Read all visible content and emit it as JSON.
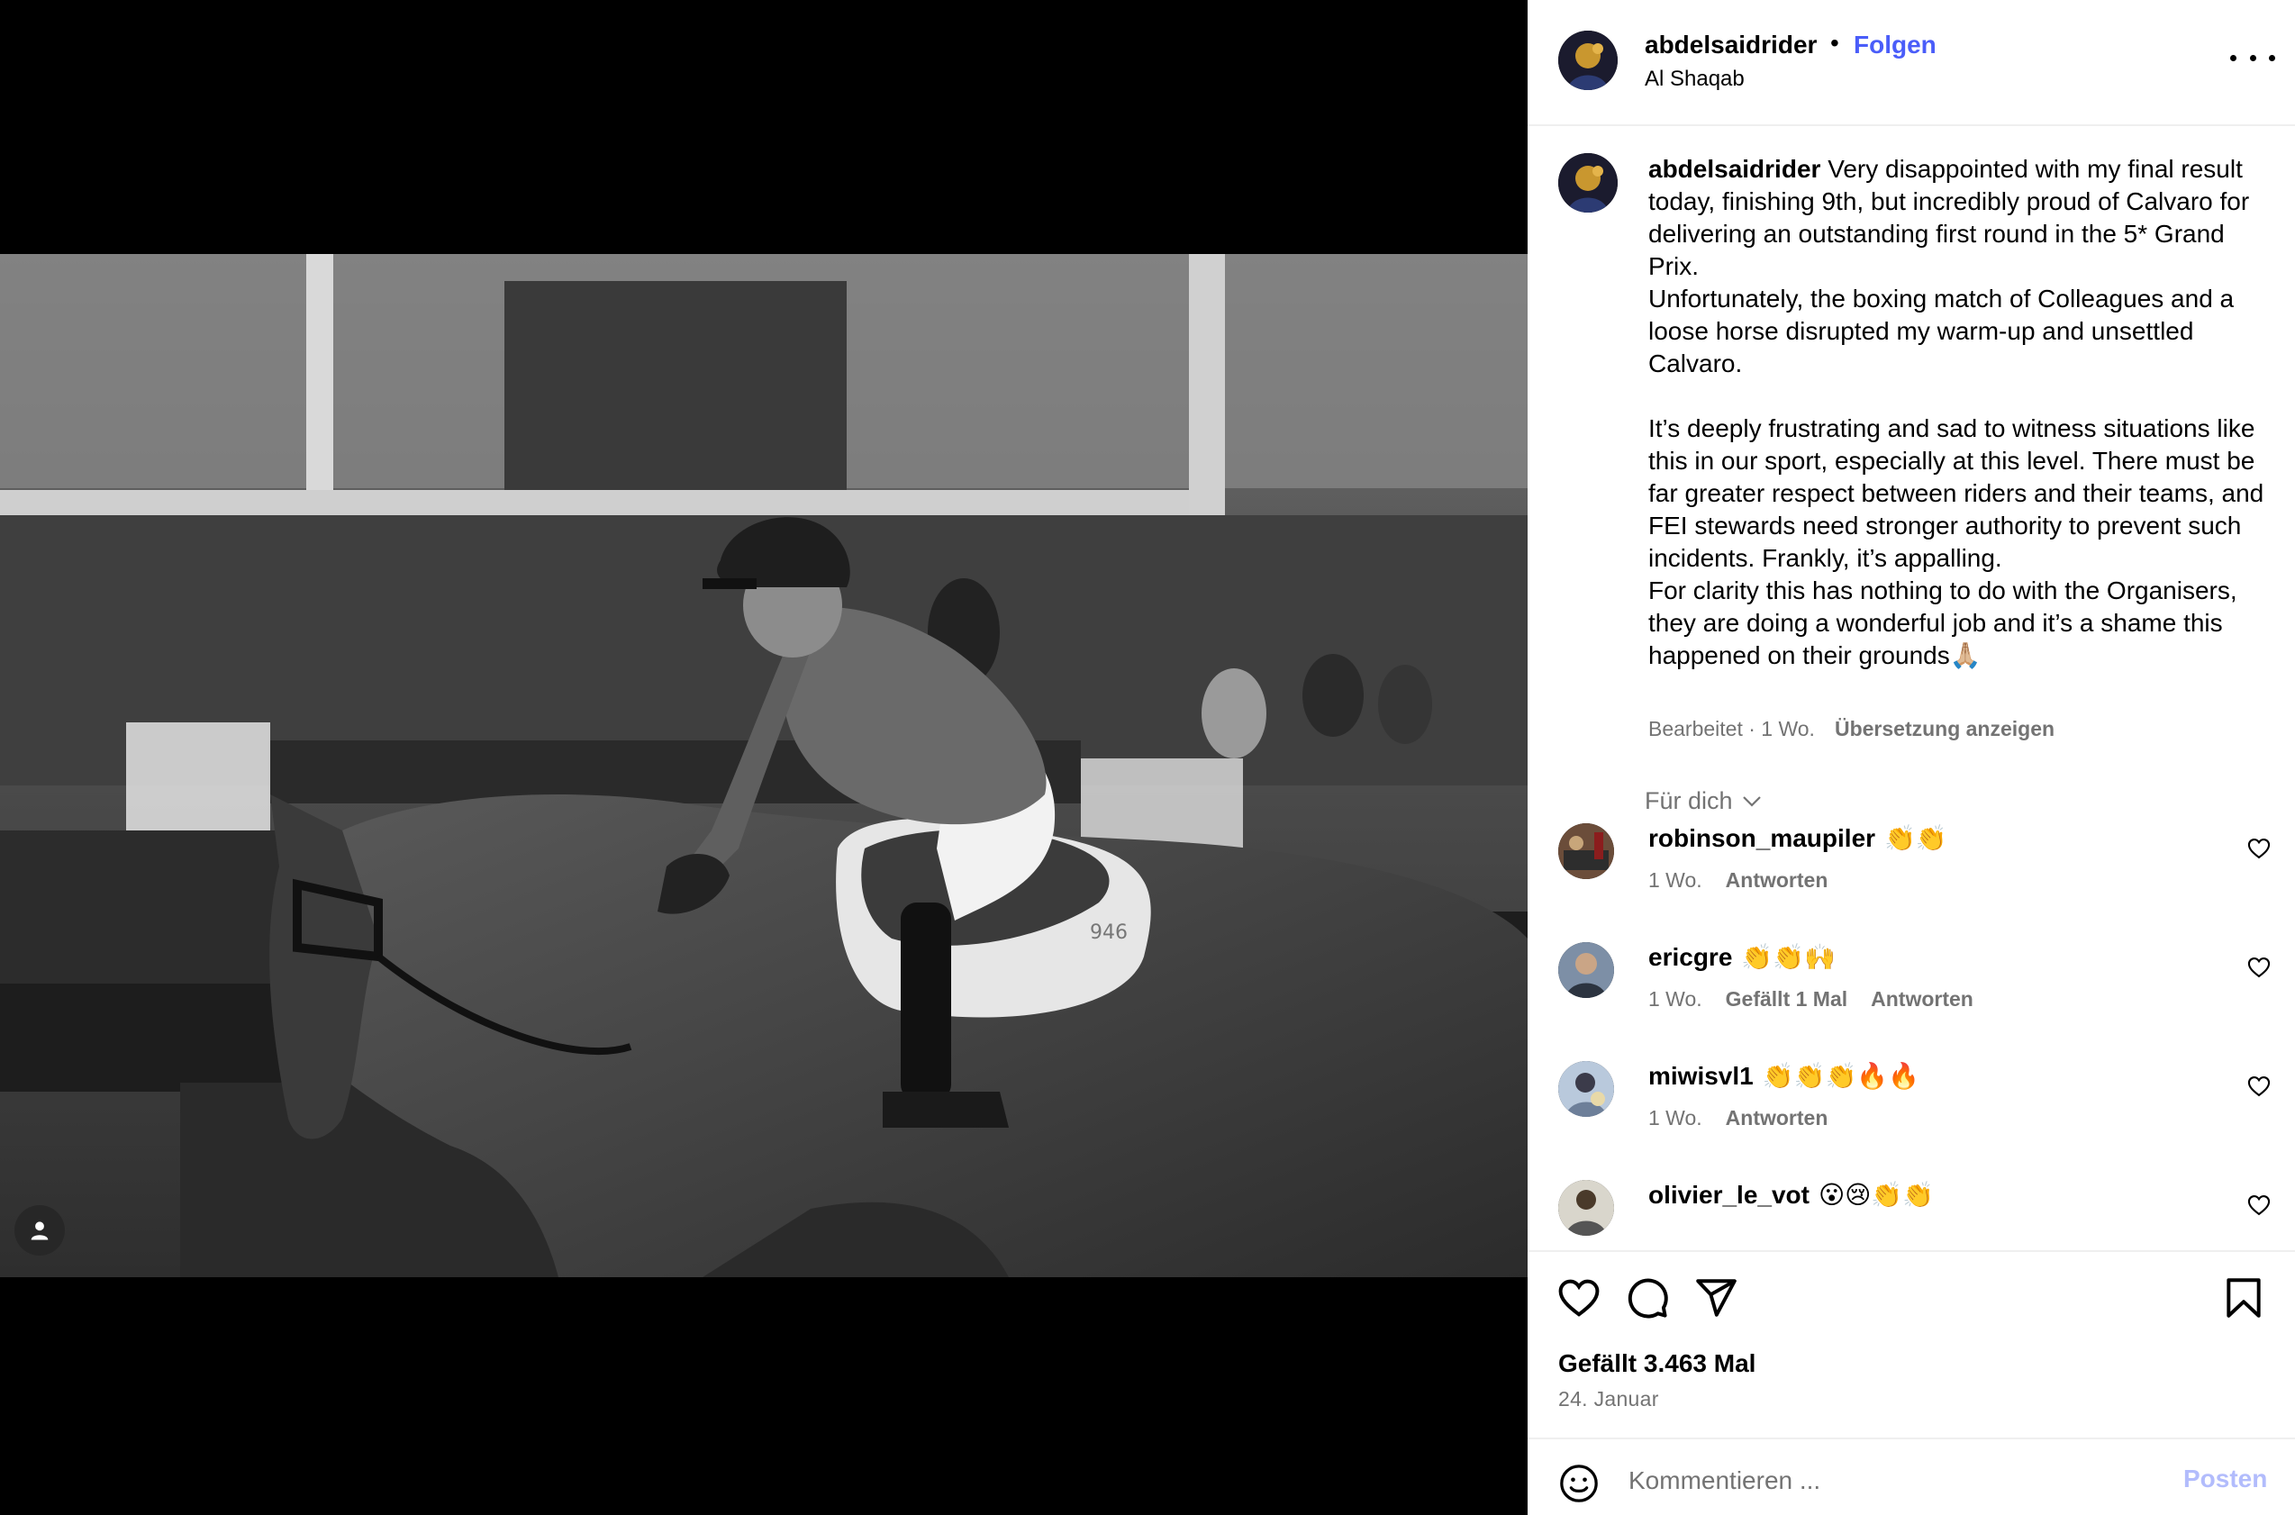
{
  "post": {
    "image_alt": "",
    "header": {
      "username": "abdelsaidrider",
      "separator": "•",
      "follow_label": "Folgen",
      "location": "Al Shaqab"
    },
    "caption": {
      "username": "abdelsaidrider",
      "text": "Very disappointed with my final result today, finishing 9th, but incredibly proud of Calvaro for delivering an outstanding first round in the 5* Grand Prix.\nUnfortunately, the boxing match of Colleagues and a loose horse disrupted my warm-up and unsettled Calvaro.\n\nIt’s deeply frustrating and sad to witness situations like this in our sport, especially at this level. There must be far greater respect between riders and their teams, and FEI stewards need stronger authority to prevent such incidents. Frankly, it’s appalling.\nFor clarity this has nothing to do with the Organisers, they are doing a wonderful job and it’s a shame this happened on their grounds🙏🏼",
      "edited_label": "Bearbeitet · 1 Wo.",
      "translate_label": "Übersetzung anzeigen"
    },
    "for_you_label": "Für dich",
    "comments": [
      {
        "username": "robinson_maupiler",
        "text": "👏👏",
        "time": "1 Wo.",
        "likes": "",
        "reply": "Antworten"
      },
      {
        "username": "ericgre",
        "text": "👏👏🙌",
        "time": "1 Wo.",
        "likes": "Gefällt 1 Mal",
        "reply": "Antworten"
      },
      {
        "username": "miwisvl1",
        "text": "👏👏👏🔥🔥",
        "time": "1 Wo.",
        "likes": "",
        "reply": "Antworten"
      },
      {
        "username": "olivier_le_vot",
        "text": "😮😢👏👏",
        "time": "",
        "likes": "",
        "reply": ""
      }
    ],
    "likes_text": "Gefällt 3.463 Mal",
    "date_text": "24. Januar",
    "composer": {
      "placeholder": "Kommentieren ...",
      "post_label": "Posten"
    }
  },
  "icons": {
    "tag": "user-tag-icon",
    "more": "more-options-icon",
    "like": "heart-icon",
    "comment": "comment-icon",
    "share": "share-icon",
    "save": "bookmark-icon",
    "emoji": "emoji-icon",
    "expand": "chevron-down-icon"
  },
  "colors": {
    "follow": "#4a5df9",
    "secondary_text": "#737373",
    "post_button_disabled": "#b2bcfc",
    "divider": "#efefef"
  }
}
